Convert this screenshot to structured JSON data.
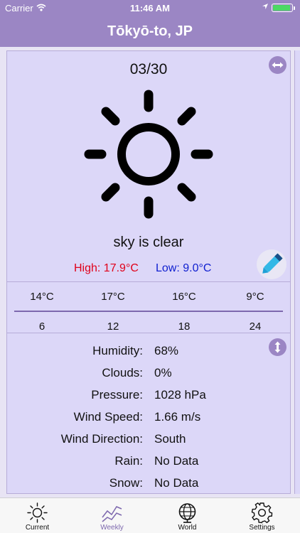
{
  "status_bar": {
    "carrier": "Carrier",
    "time": "11:46 AM"
  },
  "nav": {
    "title": "Tōkyō-to, JP"
  },
  "forecast": {
    "date": "03/30",
    "condition_icon": "sun-icon",
    "description": "sky is clear",
    "high": "High: 17.9°C",
    "low": "Low: 9.0°C",
    "hourly_temps": [
      "14°C",
      "17°C",
      "16°C",
      "9°C"
    ],
    "hours": [
      "6",
      "12",
      "18",
      "24"
    ]
  },
  "details": [
    {
      "label": "Humidity:",
      "value": "68%"
    },
    {
      "label": "Clouds:",
      "value": "0%"
    },
    {
      "label": "Pressure:",
      "value": "1028 hPa"
    },
    {
      "label": "Wind Speed:",
      "value": "1.66 m/s"
    },
    {
      "label": "Wind Direction:",
      "value": "South"
    },
    {
      "label": "Rain:",
      "value": "No Data"
    },
    {
      "label": "Snow:",
      "value": "No Data"
    }
  ],
  "tabs": [
    {
      "label": "Current",
      "icon": "sun-icon"
    },
    {
      "label": "Weekly",
      "icon": "trend-chart-icon",
      "active": true
    },
    {
      "label": "World",
      "icon": "globe-icon"
    },
    {
      "label": "Settings",
      "icon": "gear-icon"
    }
  ],
  "colors": {
    "accent": "#9b86c4",
    "high": "#e0001a",
    "low": "#1020d0"
  }
}
